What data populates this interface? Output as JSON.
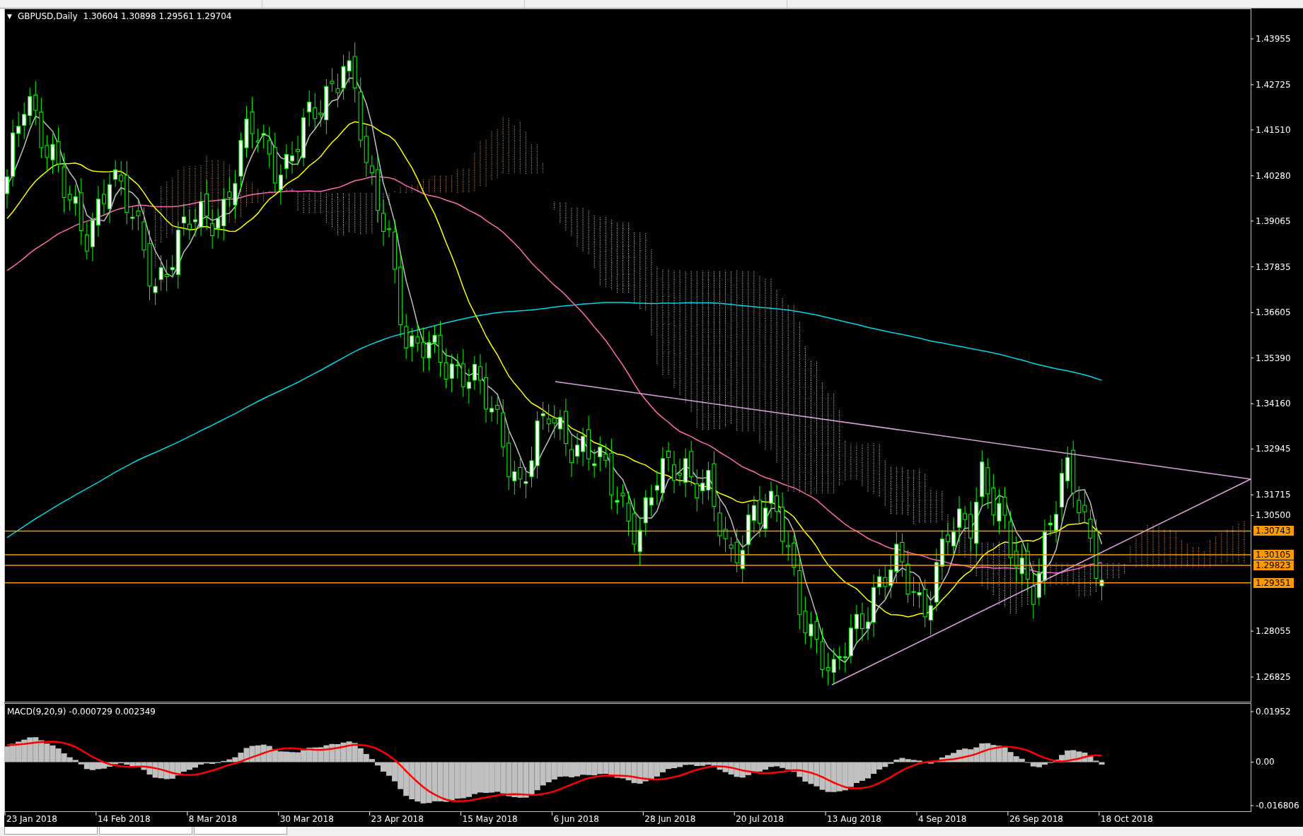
{
  "header": {
    "menu_arrow": "▼",
    "symbol": "GBPUSD,Daily",
    "ohlc": "1.30604 1.30898 1.29561 1.29704"
  },
  "price_axis": {
    "labels": [
      "1.43955",
      "1.42725",
      "1.41510",
      "1.40280",
      "1.39065",
      "1.37835",
      "1.36605",
      "1.35390",
      "1.34160",
      "1.32945",
      "1.31715",
      "1.30500",
      "1.28055",
      "1.26825"
    ]
  },
  "levels": [
    {
      "label": "1.30743"
    },
    {
      "label": "1.30105"
    },
    {
      "label": "1.29823"
    },
    {
      "label": "1.29351"
    }
  ],
  "macd": {
    "label": "MACD(9,20,9) -0.000729 0.002349",
    "axis": [
      "0.01952",
      "0.00",
      "-0.016806"
    ]
  },
  "time_axis": {
    "labels": [
      "23 Jan 2018",
      "14 Feb 2018",
      "8 Mar 2018",
      "30 Mar 2018",
      "23 Apr 2018",
      "15 May 2018",
      "6 Jun 2018",
      "28 Jun 2018",
      "20 Jul 2018",
      "13 Aug 2018",
      "4 Sep 2018",
      "26 Sep 2018",
      "18 Oct 2018"
    ]
  }
}
